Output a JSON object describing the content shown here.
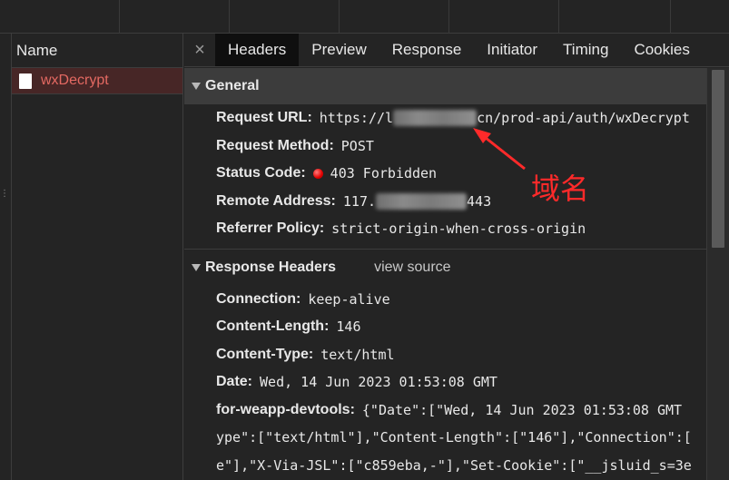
{
  "network_list": {
    "header": "Name",
    "items": [
      {
        "name": "wxDecrypt",
        "selected": true
      }
    ]
  },
  "tabs": {
    "close_glyph": "×",
    "items": [
      "Headers",
      "Preview",
      "Response",
      "Initiator",
      "Timing",
      "Cookies"
    ],
    "active": "Headers"
  },
  "general": {
    "title": "General",
    "request_url": {
      "label": "Request URL:",
      "prefix": "https://l",
      "suffix": "cn/prod-api/auth/wxDecrypt"
    },
    "request_method": {
      "label": "Request Method:",
      "value": "POST"
    },
    "status_code": {
      "label": "Status Code:",
      "value": "403 Forbidden",
      "status_color": "#e10000"
    },
    "remote_address": {
      "label": "Remote Address:",
      "prefix": "117.",
      "suffix": "443"
    },
    "referrer_policy": {
      "label": "Referrer Policy:",
      "value": "strict-origin-when-cross-origin"
    }
  },
  "response_headers": {
    "title": "Response Headers",
    "view_source": "view source",
    "items": [
      {
        "label": "Connection:",
        "value": "keep-alive"
      },
      {
        "label": "Content-Length:",
        "value": "146"
      },
      {
        "label": "Content-Type:",
        "value": "text/html"
      },
      {
        "label": "Date:",
        "value": "Wed, 14 Jun 2023 01:53:08 GMT"
      },
      {
        "label": "for-weapp-devtools:",
        "value": "{\"Date\":[\"Wed, 14 Jun 2023 01:53:08 GMT"
      }
    ],
    "wrapped_lines": [
      "ype\":[\"text/html\"],\"Content-Length\":[\"146\"],\"Connection\":[",
      "e\"],\"X-Via-JSL\":[\"c859eba,-\"],\"Set-Cookie\":[\"__jsluid_s=3e"
    ]
  },
  "annotation": {
    "label": "域名",
    "color": "#ff2a2a"
  }
}
